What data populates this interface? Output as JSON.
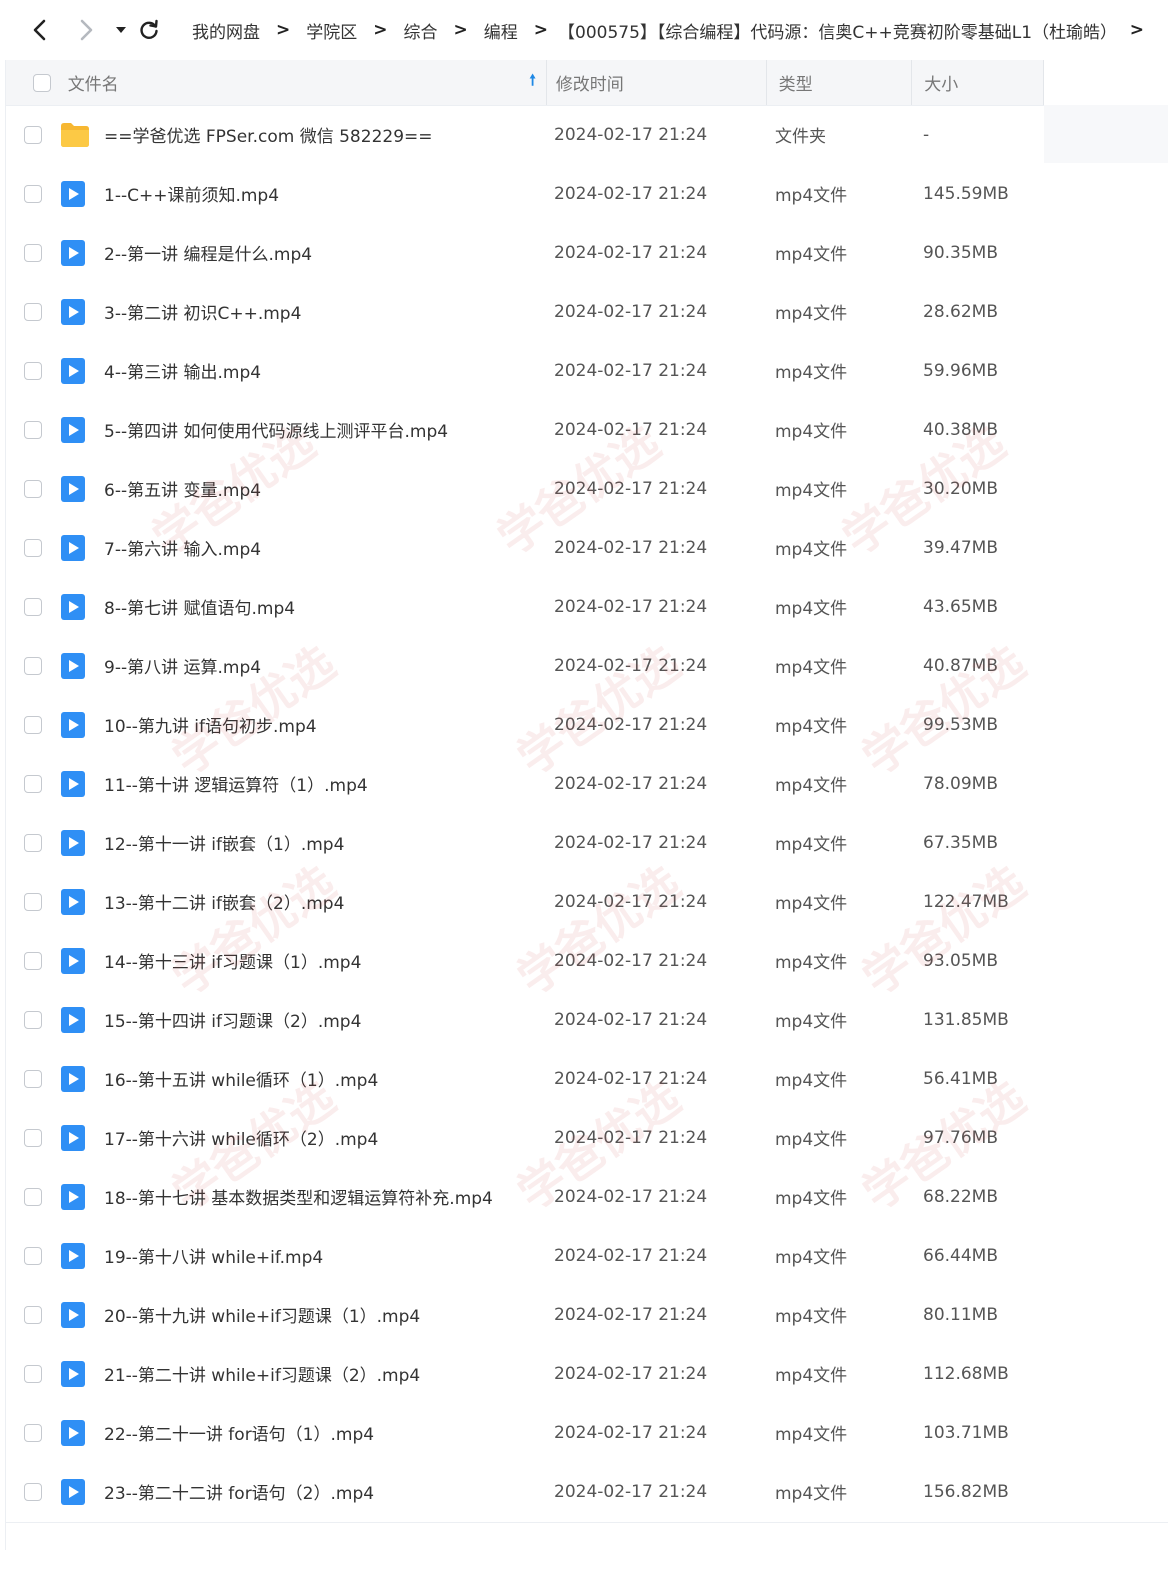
{
  "toolbar": {
    "back_icon": "chevron-left-icon",
    "forward_icon": "chevron-right-icon",
    "history_icon": "caret-down-icon",
    "refresh_icon": "refresh-icon",
    "breadcrumb": [
      "我的网盘",
      "学院区",
      "综合",
      "编程",
      "【000575】【综合编程】代码源：信奥C++竞赛初阶零基础L1（杜瑜皓）"
    ],
    "separator": ">",
    "more": ">"
  },
  "table": {
    "headers": {
      "name": "文件名",
      "modified": "修改时间",
      "type": "类型",
      "size": "大小"
    },
    "sort_icon": "arrow-up-icon",
    "rows": [
      {
        "name": "==学爸优选 FPSer.com 微信 582229==",
        "modified": "2024-02-17 21:24",
        "type": "文件夹",
        "size": "-",
        "icon": "folder-icon"
      },
      {
        "name": "1--C++课前须知.mp4",
        "modified": "2024-02-17 21:24",
        "type": "mp4文件",
        "size": "145.59MB",
        "icon": "video-icon"
      },
      {
        "name": "2--第一讲 编程是什么.mp4",
        "modified": "2024-02-17 21:24",
        "type": "mp4文件",
        "size": "90.35MB",
        "icon": "video-icon"
      },
      {
        "name": "3--第二讲 初识C++.mp4",
        "modified": "2024-02-17 21:24",
        "type": "mp4文件",
        "size": "28.62MB",
        "icon": "video-icon"
      },
      {
        "name": "4--第三讲 输出.mp4",
        "modified": "2024-02-17 21:24",
        "type": "mp4文件",
        "size": "59.96MB",
        "icon": "video-icon"
      },
      {
        "name": "5--第四讲 如何使用代码源线上测评平台.mp4",
        "modified": "2024-02-17 21:24",
        "type": "mp4文件",
        "size": "40.38MB",
        "icon": "video-icon"
      },
      {
        "name": "6--第五讲 变量.mp4",
        "modified": "2024-02-17 21:24",
        "type": "mp4文件",
        "size": "30.20MB",
        "icon": "video-icon"
      },
      {
        "name": "7--第六讲 输入.mp4",
        "modified": "2024-02-17 21:24",
        "type": "mp4文件",
        "size": "39.47MB",
        "icon": "video-icon"
      },
      {
        "name": "8--第七讲 赋值语句.mp4",
        "modified": "2024-02-17 21:24",
        "type": "mp4文件",
        "size": "43.65MB",
        "icon": "video-icon"
      },
      {
        "name": "9--第八讲 运算.mp4",
        "modified": "2024-02-17 21:24",
        "type": "mp4文件",
        "size": "40.87MB",
        "icon": "video-icon"
      },
      {
        "name": "10--第九讲 if语句初步.mp4",
        "modified": "2024-02-17 21:24",
        "type": "mp4文件",
        "size": "99.53MB",
        "icon": "video-icon"
      },
      {
        "name": "11--第十讲 逻辑运算符（1）.mp4",
        "modified": "2024-02-17 21:24",
        "type": "mp4文件",
        "size": "78.09MB",
        "icon": "video-icon"
      },
      {
        "name": "12--第十一讲 if嵌套（1）.mp4",
        "modified": "2024-02-17 21:24",
        "type": "mp4文件",
        "size": "67.35MB",
        "icon": "video-icon"
      },
      {
        "name": "13--第十二讲 if嵌套（2）.mp4",
        "modified": "2024-02-17 21:24",
        "type": "mp4文件",
        "size": "122.47MB",
        "icon": "video-icon"
      },
      {
        "name": "14--第十三讲 if习题课（1）.mp4",
        "modified": "2024-02-17 21:24",
        "type": "mp4文件",
        "size": "93.05MB",
        "icon": "video-icon"
      },
      {
        "name": "15--第十四讲 if习题课（2）.mp4",
        "modified": "2024-02-17 21:24",
        "type": "mp4文件",
        "size": "131.85MB",
        "icon": "video-icon"
      },
      {
        "name": "16--第十五讲 while循环（1）.mp4",
        "modified": "2024-02-17 21:24",
        "type": "mp4文件",
        "size": "56.41MB",
        "icon": "video-icon"
      },
      {
        "name": "17--第十六讲 while循环（2）.mp4",
        "modified": "2024-02-17 21:24",
        "type": "mp4文件",
        "size": "97.76MB",
        "icon": "video-icon"
      },
      {
        "name": "18--第十七讲 基本数据类型和逻辑运算符补充.mp4",
        "modified": "2024-02-17 21:24",
        "type": "mp4文件",
        "size": "68.22MB",
        "icon": "video-icon"
      },
      {
        "name": "19--第十八讲 while+if.mp4",
        "modified": "2024-02-17 21:24",
        "type": "mp4文件",
        "size": "66.44MB",
        "icon": "video-icon"
      },
      {
        "name": "20--第十九讲 while+if习题课（1）.mp4",
        "modified": "2024-02-17 21:24",
        "type": "mp4文件",
        "size": "80.11MB",
        "icon": "video-icon"
      },
      {
        "name": "21--第二十讲 while+if习题课（2）.mp4",
        "modified": "2024-02-17 21:24",
        "type": "mp4文件",
        "size": "112.68MB",
        "icon": "video-icon"
      },
      {
        "name": "22--第二十一讲 for语句（1）.mp4",
        "modified": "2024-02-17 21:24",
        "type": "mp4文件",
        "size": "103.71MB",
        "icon": "video-icon"
      },
      {
        "name": "23--第二十二讲 for语句（2）.mp4",
        "modified": "2024-02-17 21:24",
        "type": "mp4文件",
        "size": "156.82MB",
        "icon": "video-icon"
      }
    ]
  },
  "watermark": {
    "text": "学爸优选",
    "icon": "watermark-logo"
  },
  "colors": {
    "accent": "#1e88e5",
    "folder": "#f7b731",
    "video": "#2f8ff5",
    "header_bg": "#f5f6f8"
  }
}
